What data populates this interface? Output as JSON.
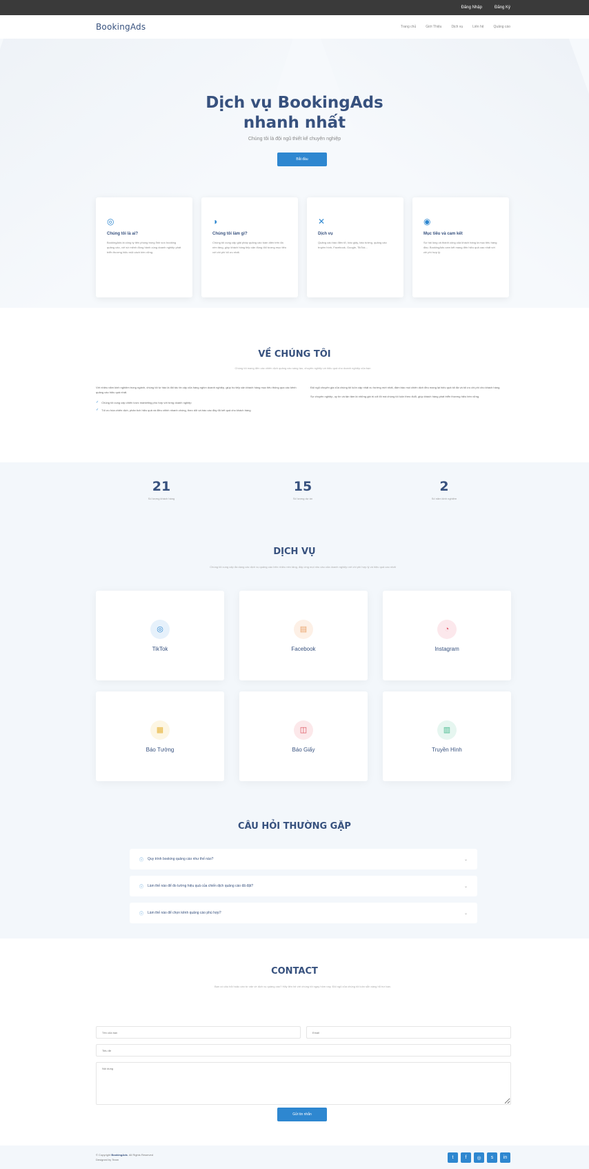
{
  "topbar": {
    "login": "Đăng Nhập",
    "register": "Đăng Ký"
  },
  "header": {
    "logo": "BookingAds",
    "nav": [
      "Trang chủ",
      "Giới Thiệu",
      "Dịch vụ",
      "Liên hệ",
      "Quảng cáo"
    ]
  },
  "hero": {
    "title_line1": "Dịch vụ BookingAds",
    "title_line2": "nhanh nhất",
    "subtitle": "Chúng tôi là đội ngũ thiết kế chuyên nghiệp",
    "cta": "Bắt đầu"
  },
  "features": [
    {
      "title": "Chúng tôi là ai?",
      "text": "BookingAds là công ty tiên phong trong lĩnh vực booking quảng cáo, với sứ mệnh đồng hành cùng doanh nghiệp phát triển thương hiệu một cách bền vững."
    },
    {
      "title": "Chúng tôi làm gì?",
      "text": "Chúng tôi cung cấp giải pháp quảng cáo toàn diện trên đa nền tảng, giúp khách hàng tiếp cận đúng đối tượng mục tiêu với chi phí tối ưu nhất."
    },
    {
      "title": "Dịch vụ",
      "text": "Quảng cáo báo điện tử, báo giấy, báo tường, quảng cáo truyền hình, Facebook, Google, TikTok..."
    },
    {
      "title": "Mục tiêu và cam kết",
      "text": "Sự hài lòng và thành công của khách hàng là mục tiêu hàng đầu. BookingAds cam kết mang đến hiệu quả cao nhất với chi phí hợp lý."
    }
  ],
  "about": {
    "title": "VỀ CHÚNG TÔI",
    "desc": "Chúng tôi mang đến các chiến dịch quảng cáo sáng tạo, chuyên nghiệp và hiệu quả cho doanh nghiệp của bạn",
    "left_text": "Với nhiều năm kinh nghiệm trong ngành, chúng tôi tự hào là đối tác tin cậy của hàng nghìn doanh nghiệp, giúp họ tiếp cận khách hàng mục tiêu thông qua các kênh quảng cáo hiệu quả nhất.",
    "bullets": [
      "Chúng tôi cung cấp chiến lược marketing phù hợp với từng doanh nghiệp",
      "Tối ưu hóa chiến dịch, phân tích hiệu quả và điều chỉnh nhanh chóng, theo dõi và báo cáo đầy đủ kết quả cho khách hàng"
    ],
    "right_p1": "Đội ngũ chuyên gia của chúng tôi luôn cập nhật xu hướng mới nhất, đảm bảo mọi chiến dịch đều mang lại hiệu quả tối đa và tối ưu chi phí cho khách hàng.",
    "right_p2": "Sự chuyên nghiệp, uy tín và tận tâm là những giá trị cốt lõi mà chúng tôi luôn theo đuổi, giúp khách hàng phát triển thương hiệu bền vững."
  },
  "stats": [
    {
      "num": "21",
      "label": "Số lượng khách hàng"
    },
    {
      "num": "15",
      "label": "Số lượng dự án"
    },
    {
      "num": "2",
      "label": "Số năm kinh nghiệm"
    }
  ],
  "services": {
    "title": "DỊCH VỤ",
    "desc": "Chúng tôi cung cấp đa dạng các dịch vụ quảng cáo trên nhiều nền tảng, đáp ứng mọi nhu cầu của doanh nghiệp với chi phí hợp lý và hiệu quả cao nhất",
    "items": [
      {
        "name": "TikTok",
        "icon": "globe-icon",
        "color": "#2e87d0",
        "bg": "#e6f1fb",
        "glyph": "◎"
      },
      {
        "name": "Facebook",
        "icon": "file-icon",
        "color": "#e9a36b",
        "bg": "#fdf0e6",
        "glyph": "▤"
      },
      {
        "name": "Instagram",
        "icon": "speedometer-icon",
        "color": "#e2566b",
        "bg": "#fce8ec",
        "glyph": "◔"
      },
      {
        "name": "Báo Tường",
        "icon": "layers-icon",
        "color": "#e6b43c",
        "bg": "#fdf6e3",
        "glyph": "▦"
      },
      {
        "name": "Báo Giấy",
        "icon": "slideshow-icon",
        "color": "#d94a55",
        "bg": "#fce8ea",
        "glyph": "◫"
      },
      {
        "name": "Truyền Hình",
        "icon": "calendar-icon",
        "color": "#47b98f",
        "bg": "#e6f6f0",
        "glyph": "▥"
      }
    ]
  },
  "faq": {
    "title": "CÂU HỎI THƯỜNG GẶP",
    "items": [
      "Quy trình booking quảng cáo như thế nào?",
      "Làm thế nào để đo lường hiệu quả của chiến dịch quảng cáo đã đặt?",
      "Làm thế nào để chọn kênh quảng cáo phù hợp?"
    ]
  },
  "contact": {
    "title": "CONTACT",
    "desc": "Bạn có câu hỏi hoặc cần tư vấn về dịch vụ quảng cáo? Hãy liên hệ với chúng tôi ngay hôm nay. Đội ngũ của chúng tôi luôn sẵn sàng hỗ trợ bạn.",
    "name_ph": "Tên của bạn",
    "email_ph": "Email",
    "subject_ph": "Tiêu đề",
    "message_ph": "Nội dung",
    "send": "Gửi tin nhắn"
  },
  "footer": {
    "copy_prefix": "© Copyright",
    "brand": "BookingAds",
    "copy_suffix": ". All Rights Reserved",
    "designed": "Designed by Team"
  },
  "colors": {
    "primary": "#2e87d0",
    "heading": "#37517e",
    "band": "#f3f7fb"
  }
}
